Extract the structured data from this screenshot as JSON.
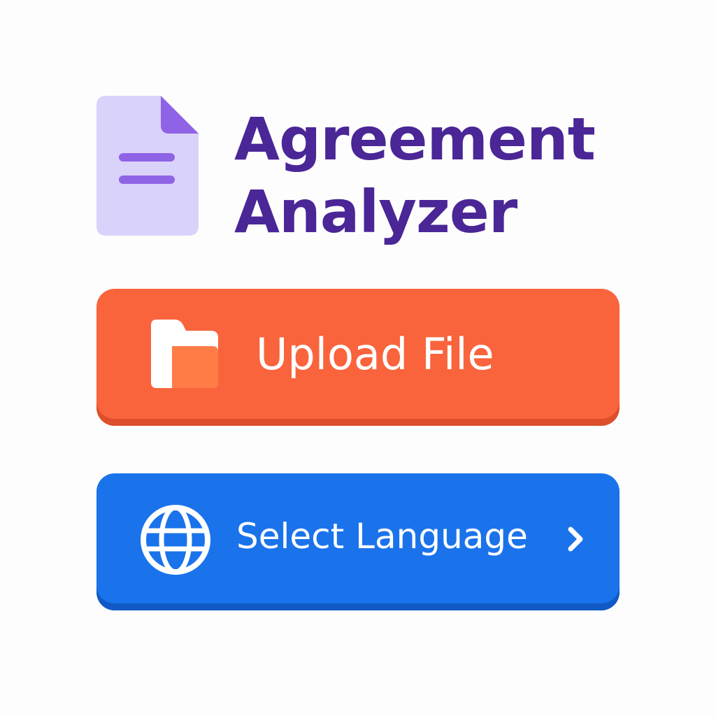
{
  "app": {
    "title_line1": "Agreement",
    "title_line2": "Analyzer",
    "icon": "document-icon"
  },
  "actions": {
    "upload": {
      "label": "Upload File",
      "icon": "folder-icon"
    },
    "language": {
      "label": "Select Language",
      "icon": "globe-icon",
      "trailing_icon": "chevron-right-icon"
    }
  },
  "colors": {
    "title": "#4a2696",
    "document_body": "#d9d2fb",
    "document_accent": "#8f63e6",
    "upload": "#fa643c",
    "upload_shadow": "#dc4e2c",
    "language": "#1a73ea",
    "language_shadow": "#115ac6",
    "folder_front": "#ff7c47"
  }
}
